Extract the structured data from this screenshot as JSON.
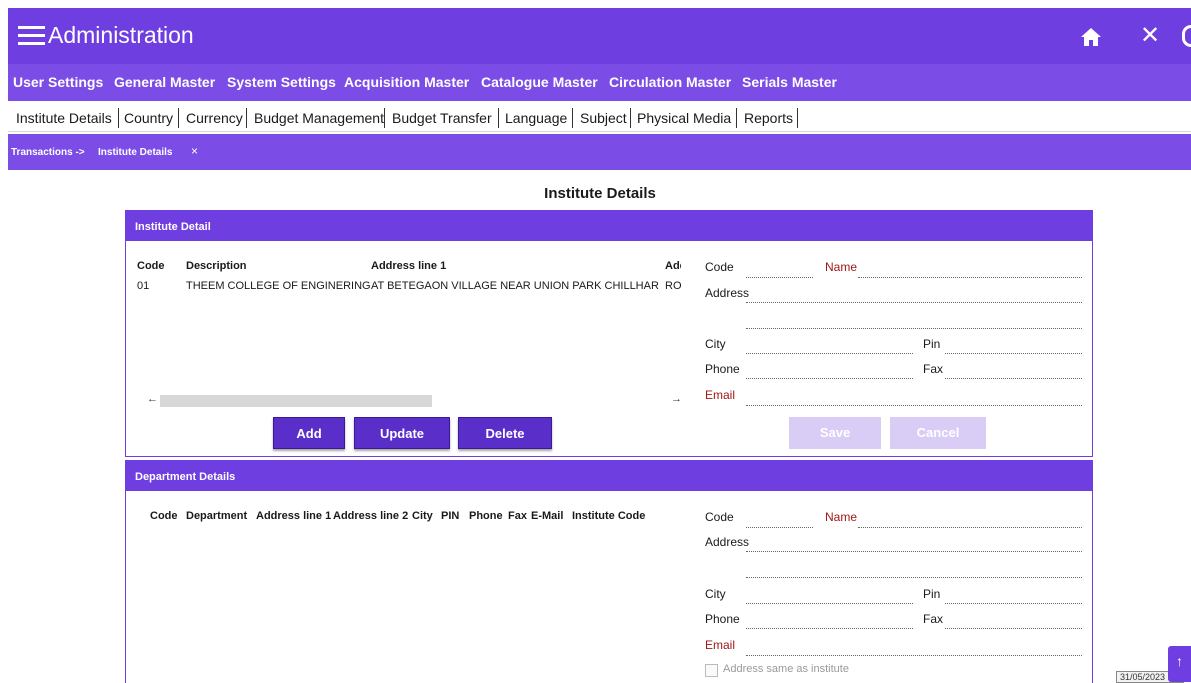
{
  "app": {
    "title": "Administration"
  },
  "main_menu": [
    "User Settings",
    "General Master",
    "System Settings",
    "Acquisition Master",
    "Catalogue Master",
    "Circulation Master",
    "Serials Master"
  ],
  "sub_menu": [
    "Institute Details",
    "Country",
    "Currency",
    "Budget Management",
    "Budget Transfer",
    "Language",
    "Subject",
    "Physical Media",
    "Reports"
  ],
  "breadcrumb": {
    "prefix": "Transactions ->",
    "current": "Institute Details",
    "close": "×"
  },
  "page_title": "Institute Details",
  "institute_panel": {
    "header": "Institute Detail",
    "columns": [
      "Code",
      "Description",
      "Address line 1",
      "Adc"
    ],
    "rows": [
      [
        "01",
        "THEEM COLLEGE OF ENGINERING",
        "AT BETEGAON VILLAGE NEAR UNION PARK CHILLHAR",
        "ROA"
      ]
    ],
    "scroll_left": "←",
    "scroll_right": "→",
    "buttons": {
      "add": "Add",
      "update": "Update",
      "delete": "Delete"
    },
    "form": {
      "code": "Code",
      "name": "Name",
      "address": "Address",
      "city": "City",
      "pin": "Pin",
      "phone": "Phone",
      "fax": "Fax",
      "email": "Email"
    },
    "form_buttons": {
      "save": "Save",
      "cancel": "Cancel"
    }
  },
  "department_panel": {
    "header": "Department Details",
    "columns": [
      "Code",
      "Department",
      "Address line 1",
      "Address line 2",
      "City",
      "PIN",
      "Phone",
      "Fax",
      "E-Mail",
      "Institute Code"
    ],
    "form": {
      "code": "Code",
      "name": "Name",
      "address": "Address",
      "city": "City",
      "pin": "Pin",
      "phone": "Phone",
      "fax": "Fax",
      "email": "Email"
    },
    "checkbox_label": "Address same as institute"
  },
  "status": {
    "date": "31/05/2023"
  },
  "colors": {
    "primary": "#6f3ee0",
    "menu": "#7b4ce6",
    "button": "#5a2fc9",
    "required": "#a01818"
  },
  "icons": {
    "menu": "hamburger-icon",
    "home": "home-icon",
    "close": "close-icon"
  }
}
